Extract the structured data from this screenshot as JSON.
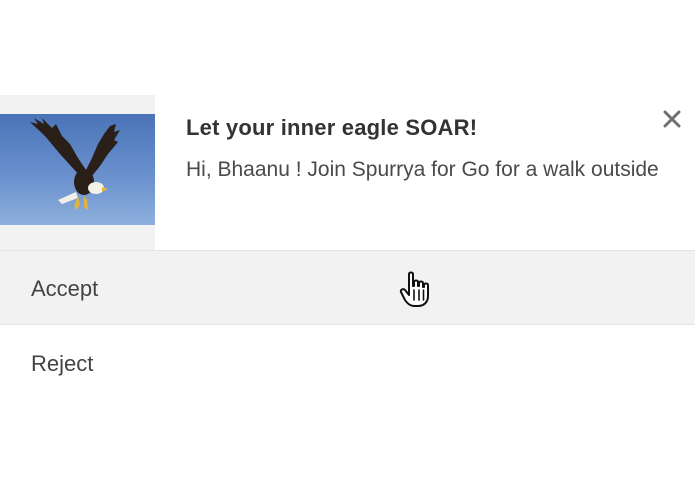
{
  "notification": {
    "title": "Let your inner eagle SOAR!",
    "message": "Hi, Bhaanu ! Join Spurrya for Go for a walk outside",
    "image_icon": "bald-eagle-image",
    "close_icon": "close-icon"
  },
  "actions": {
    "accept_label": "Accept",
    "reject_label": "Reject"
  },
  "cursor": {
    "icon": "hand-pointer-icon"
  },
  "colors": {
    "accent_bg": "#f2f2f2",
    "text_title": "#333333",
    "text_body": "#4a4a4a"
  }
}
